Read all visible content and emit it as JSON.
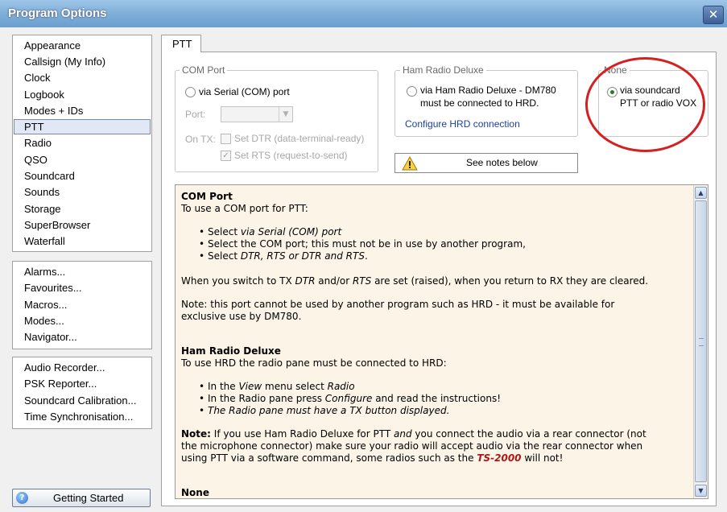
{
  "window": {
    "title": "Program Options",
    "close_glyph": "✕"
  },
  "nav": {
    "group1": [
      "Appearance",
      "Callsign (My Info)",
      "Clock",
      "Logbook",
      "Modes + IDs",
      "PTT",
      "Radio",
      "QSO",
      "Soundcard",
      "Sounds",
      "Storage",
      "SuperBrowser",
      "Waterfall"
    ],
    "selected": "PTT",
    "group2": [
      "Alarms...",
      "Favourites...",
      "Macros...",
      "Modes...",
      "Navigator..."
    ],
    "group3": [
      "Audio Recorder...",
      "PSK Reporter...",
      "Soundcard Calibration...",
      "Time Synchronisation..."
    ],
    "getting_started": "Getting Started"
  },
  "tab": {
    "label": "PTT"
  },
  "com_port": {
    "title": "COM Port",
    "radio_label": "via Serial (COM) port",
    "port_label": "Port:",
    "on_tx_label": "On TX:",
    "dtr_label": "Set DTR (data-terminal-ready)",
    "rts_label": "Set RTS (request-to-send)"
  },
  "hrd": {
    "title": "Ham Radio Deluxe",
    "radio_line1": "via Ham Radio Deluxe - DM780",
    "radio_line2": "must be connected to HRD.",
    "link": "Configure HRD connection"
  },
  "none": {
    "title": "None",
    "radio_line1": "via soundcard",
    "radio_line2": "PTT or radio VOX"
  },
  "notes_button": "See notes below",
  "notes": {
    "com_heading": "COM Port",
    "com_intro": "To use a COM port for PTT:",
    "com_b1_pre": "Select ",
    "com_b1_em": "via Serial (COM) port",
    "com_b2": "Select the COM port; this must not be in use by another program,",
    "com_b3_pre": "Select ",
    "com_b3_em": "DTR, RTS or DTR and RTS",
    "com_b3_post": ".",
    "switch_pre": "When you switch to TX ",
    "switch_em1": "DTR",
    "switch_mid": " and/or ",
    "switch_em2": "RTS",
    "switch_post": " are set (raised), when you return to RX they are cleared.",
    "note1_line1": "Note: this port cannot be used by another program such as HRD - it must be available for",
    "note1_line2": "exclusive use by DM780.",
    "hrd_heading": "Ham Radio Deluxe",
    "hrd_intro": "To use HRD the radio pane must be connected to HRD:",
    "hrd_b1_pre": "In the ",
    "hrd_b1_em1": "View",
    "hrd_b1_mid": " menu select ",
    "hrd_b1_em2": "Radio",
    "hrd_b2_pre": "In the Radio pane press ",
    "hrd_b2_em": "Configure",
    "hrd_b2_post": " and read the instructions!",
    "hrd_b3_em": "The Radio pane must have a TX button displayed.",
    "note2_bold": "Note:",
    "note2_l1_a": " If you use Ham Radio Deluxe for PTT ",
    "note2_l1_em": "and",
    "note2_l1_b": " you connect the audio via a rear connector (not",
    "note2_line2": "the microphone connector) make sure your radio will accept audio via the rear connector when",
    "note2_l3_a": "using PTT via a software command, some radios such as the ",
    "note2_l3_red": "TS-2000",
    "note2_l3_b": " will not!",
    "none_heading": "None"
  },
  "colors": {
    "title_gradient_top": "#9ec5e8",
    "highlight_circle": "#d42020",
    "notes_bg": "#fbf4e7"
  }
}
